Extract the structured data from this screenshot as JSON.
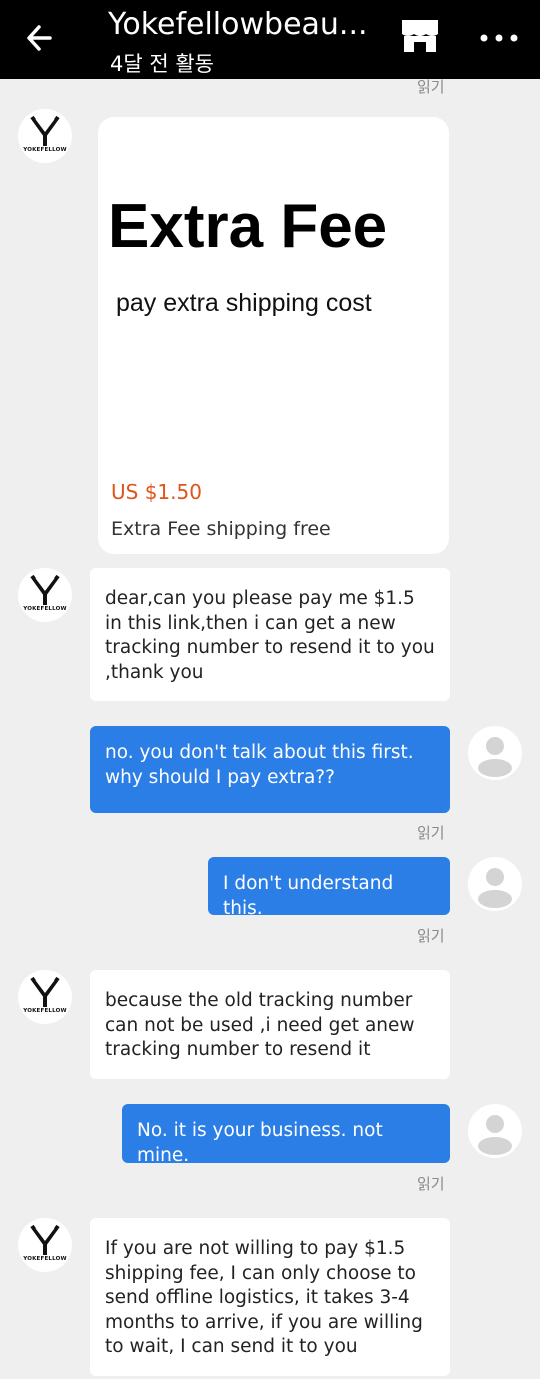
{
  "header": {
    "title": "Yokefellowbeau...",
    "subtitle": "4달 전 활동",
    "back_icon": "arrow-left-icon",
    "store_icon": "store-icon",
    "more_icon": "more-horizontal-icon"
  },
  "seller": {
    "logo_text": "YOKEFELLOW"
  },
  "read_label": "읽기",
  "product_card": {
    "image_title": "Extra Fee",
    "image_subtitle": "pay extra shipping cost",
    "price": "US $1.50",
    "name": "Extra Fee shipping free"
  },
  "messages": [
    {
      "from": "seller",
      "text": "dear,can you please pay me $1.5 in this link,then i can get a new tracking number to resend it to you ,thank you"
    },
    {
      "from": "me",
      "text": "no. you don't talk about this first. why should I pay extra??"
    },
    {
      "from": "me",
      "text": "I don't understand this."
    },
    {
      "from": "seller",
      "text": "because the old tracking number can not be used ,i need get anew tracking number to resend it"
    },
    {
      "from": "me",
      "text": "No. it is your business. not mine."
    },
    {
      "from": "seller",
      "text": "If you are not willing to pay $1.5 shipping fee, I can only choose to send offline logistics, it takes 3-4 months to arrive, if you are willing to wait, I can send it to you"
    }
  ],
  "colors": {
    "header_bg": "#000000",
    "outgoing_bubble": "#2b7ee6",
    "incoming_bubble": "#ffffff",
    "price": "#e0531b",
    "background": "#efefef"
  }
}
